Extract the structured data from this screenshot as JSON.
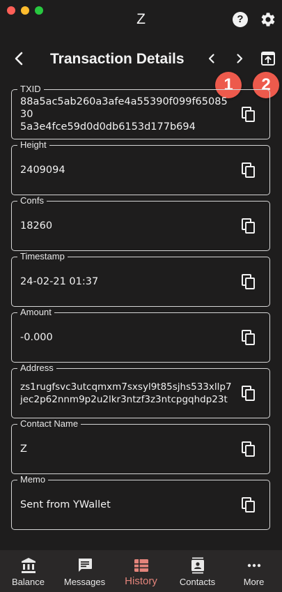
{
  "window": {
    "title": "Z"
  },
  "header": {
    "title": "Transaction Details"
  },
  "badges": [
    "1",
    "2"
  ],
  "fields": [
    {
      "label": "TXID",
      "value": "88a5ac5ab260a3afe4a55390f099f6508530\n5a3e4fce59d0d0db6153d177b694"
    },
    {
      "label": "Height",
      "value": "2409094"
    },
    {
      "label": "Confs",
      "value": "18260"
    },
    {
      "label": "Timestamp",
      "value": "24-02-21 01:37"
    },
    {
      "label": "Amount",
      "value": "-0.000"
    },
    {
      "label": "Address",
      "value": "zs1rugfsvc3utcqmxm7sxsyl9t85sjhs533xllp7\njec2p62nnm9p2u2lkr3ntzf3z3ntcpgqhdp23t"
    },
    {
      "label": "Contact Name",
      "value": "Z"
    },
    {
      "label": "Memo",
      "value": "Sent from YWallet"
    }
  ],
  "nav": [
    {
      "label": "Balance",
      "icon": "bank-icon"
    },
    {
      "label": "Messages",
      "icon": "message-icon"
    },
    {
      "label": "History",
      "icon": "history-icon",
      "active": true
    },
    {
      "label": "Contacts",
      "icon": "contacts-icon"
    },
    {
      "label": "More",
      "icon": "more-icon"
    }
  ],
  "colors": {
    "background": "#1e1d1d",
    "accent": "#e3847b",
    "badge": "#ed5a4c",
    "nav_bg": "#2a2828"
  }
}
